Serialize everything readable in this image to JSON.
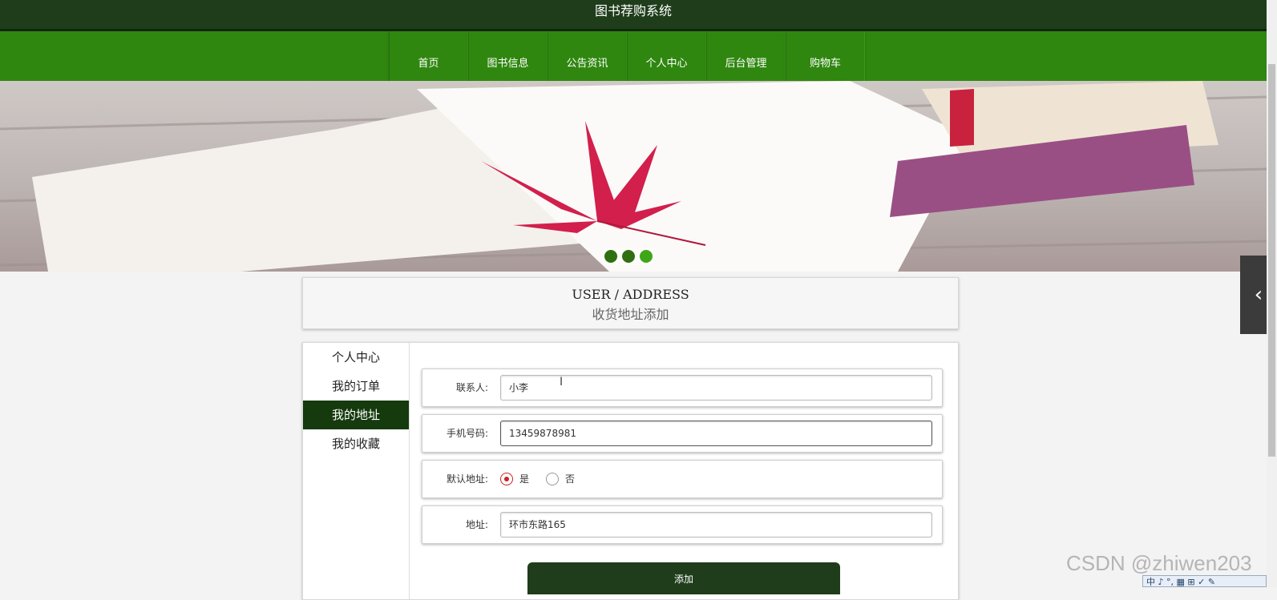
{
  "header": {
    "title": "图书荐购系统"
  },
  "nav": {
    "items": [
      {
        "label": "首页"
      },
      {
        "label": "图书信息"
      },
      {
        "label": "公告资讯"
      },
      {
        "label": "个人中心"
      },
      {
        "label": "后台管理"
      },
      {
        "label": "购物车"
      }
    ]
  },
  "carousel": {
    "slides": 3,
    "active_index": 2
  },
  "page_title": {
    "en": "USER / ADDRESS",
    "cn": "收货地址添加"
  },
  "sidebar": {
    "items": [
      {
        "label": "个人中心",
        "active": false
      },
      {
        "label": "我的订单",
        "active": false
      },
      {
        "label": "我的地址",
        "active": true
      },
      {
        "label": "我的收藏",
        "active": false
      }
    ]
  },
  "form": {
    "contact": {
      "label": "联系人:",
      "value": "小李"
    },
    "phone": {
      "label": "手机号码:",
      "value": "13459878981"
    },
    "default_address": {
      "label": "默认地址:",
      "options": [
        {
          "label": "是",
          "checked": true
        },
        {
          "label": "否",
          "checked": false
        }
      ]
    },
    "address": {
      "label": "地址:",
      "value": "环市东路165"
    },
    "submit_label": "添加"
  },
  "watermark": "CSDN @zhiwen203",
  "ime": {
    "text": "中 ♪ °, ▦ ⊞ ✓ ✎"
  },
  "colors": {
    "nav": "#2f870f",
    "dark": "#1f3d1b",
    "active": "#143a0d",
    "radio": "#cc2222"
  }
}
